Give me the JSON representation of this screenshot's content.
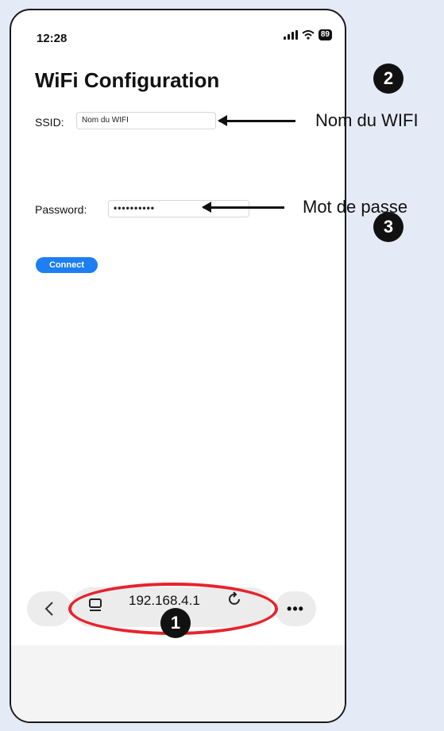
{
  "status_bar": {
    "time": "12:28",
    "battery": "89"
  },
  "page": {
    "title": "WiFi Configuration"
  },
  "form": {
    "ssid_label": "SSID:",
    "ssid_value": "Nom du WIFI",
    "password_label": "Password:",
    "password_value": "••••••••••",
    "connect_label": "Connect"
  },
  "browser_bar": {
    "url": "192.168.4.1",
    "more_label": "•••"
  },
  "annotations": {
    "badge_1": "1",
    "badge_2": "2",
    "badge_3": "3",
    "ssid_note": "Nom du WIFI",
    "password_note": "Mot de passe"
  },
  "colors": {
    "accent": "#1e7ef3",
    "highlight": "#e8222c",
    "background": "#e4ebf6"
  }
}
